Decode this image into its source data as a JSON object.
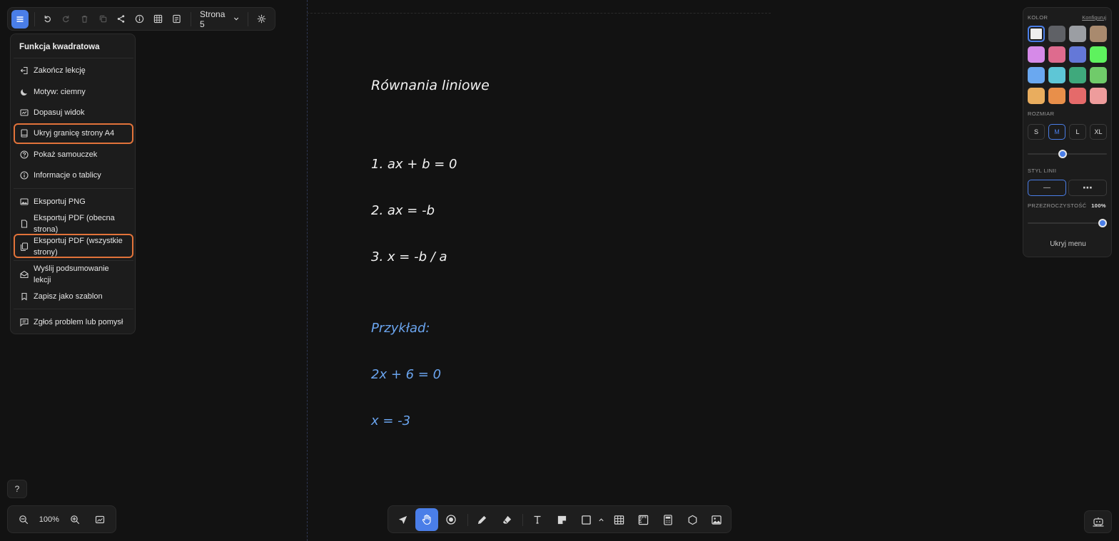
{
  "toolbar": {
    "page_label": "Strona 5",
    "buttons": [
      "menu-icon",
      "undo-icon",
      "redo-icon",
      "trash-icon",
      "duplicate-icon",
      "share-icon",
      "info-icon",
      "grid-icon",
      "notes-icon"
    ]
  },
  "menu": {
    "title": "Funkcja kwadratowa",
    "items": {
      "end_lesson": "Zakończ lekcję",
      "theme": "Motyw: ciemny",
      "fit_view": "Dopasuj widok",
      "hide_a4": "Ukryj granicę strony A4",
      "tutorial": "Pokaż samouczek",
      "board_info": "Informacje o tablicy",
      "export_png": "Eksportuj PNG",
      "export_pdf_current_1": "Eksportuj PDF (obecna",
      "export_pdf_current_2": "strona)",
      "export_pdf_all_1": "Eksportuj PDF (wszystkie",
      "export_pdf_all_2": "strony)",
      "send_summary_1": "Wyślij podsumowanie",
      "send_summary_2": "lekcji",
      "save_template": "Zapisz jako szablon",
      "report": "Zgłoś problem lub pomysł"
    }
  },
  "canvas": {
    "title": "Równania liniowe",
    "eq1": "1.  ax + b = 0",
    "eq2": "2.  ax = -b",
    "eq3": "3.  x = -b / a",
    "example_label": "Przykład:",
    "example1": "2x + 6 = 0",
    "example2": "x = -3"
  },
  "panel": {
    "color_label": "KOLOR",
    "configure_link": "Konfiguruj",
    "colors": [
      "#eeeeee",
      "#5f6166",
      "#9b9ea3",
      "#a98a6e",
      "#d68ae8",
      "#de6b8e",
      "#6478d8",
      "#5ef25e",
      "#6aa8f0",
      "#5ec6d6",
      "#3fa97c",
      "#70cb6a",
      "#e9ad5e",
      "#e88f4a",
      "#e56a6a",
      "#ee9c9c"
    ],
    "selected_color": 0,
    "size_label": "ROZMIAR",
    "sizes": [
      "S",
      "M",
      "L",
      "XL"
    ],
    "selected_size": "M",
    "size_slider": 0.43,
    "line_style_label": "STYL LINII",
    "line_styles": [
      "—",
      "⋯"
    ],
    "opacity_label": "PRZEZROCZYSTOŚĆ",
    "opacity_value": "100%",
    "opacity_slider": 1.0,
    "hide_menu": "Ukryj menu"
  },
  "zoom": {
    "value": "100%",
    "help": "?"
  },
  "accent": "#4a7ee8",
  "highlight": "#e2733a"
}
